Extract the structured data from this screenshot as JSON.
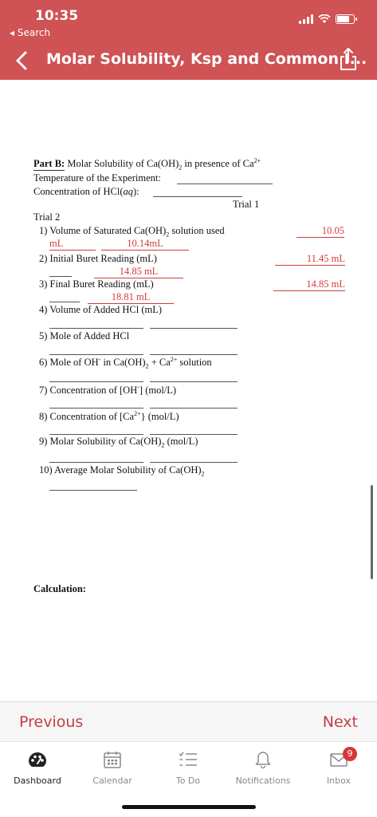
{
  "status_bar": {
    "time": "10:35",
    "back_label": "◂ Search"
  },
  "header": {
    "title": "Molar Solubility, Ksp and Common I..."
  },
  "document": {
    "part_label": "Part B:",
    "part_title": " Molar Solubility of Ca(OH)",
    "part_title_sub": "2",
    "part_title_rest": " in presence of Ca",
    "part_title_sup": "2+",
    "temperature_label": "Temperature of the Experiment:",
    "concentration_label": "Concentration of HCl(",
    "concentration_aq": "aq",
    "concentration_close": "):",
    "trial1_header": "Trial    1",
    "trial2_header": "Trial 2",
    "q1_label": "1) Volume of Saturated Ca(OH)",
    "q1_sub": "2",
    "q1_rest": " solution used",
    "q1_trial1": "10.05",
    "q1_unit": "mL",
    "q1_trial2": "10.14mL",
    "q2_label": "2)  Initial  Buret  Reading  (mL)",
    "q2_trial1": "11.45  mL",
    "q2_trial2": "14.85 mL",
    "q3_label": "3)  Final  Buret  Reading  (mL)",
    "q3_trial1": "14.85  mL",
    "q3_trial2": "18.81 mL",
    "q4_label": "4)      Volume      of      Added      HCl      (mL)",
    "q5_label": "5)        Mole        of        Added        HCl",
    "q6_label": "6)   Mole   of   OH",
    "q6_sup": "-",
    "q6_rest": "   in   Ca(OH)",
    "q6_sub": "2",
    "q6_rest2": "   +   Ca",
    "q6_sup2": "2+",
    "q6_rest3": "   solution",
    "q7_label": "7)      Concentration      of      [OH",
    "q7_sup": "-",
    "q7_rest": "]      (mol/L)",
    "q8_label": "8)        Concentration        of        [Ca",
    "q8_sup": "2+",
    "q8_rest": "}        (mol/L)",
    "q9_label": "9)    Molar    Solubility    of    Ca(OH)",
    "q9_sub": "2",
    "q9_rest": "    (mol/L)",
    "q10_label": "10) Average Molar Solubility of Ca(OH)",
    "q10_sub": "2",
    "calculation_label": "Calculation:"
  },
  "nav": {
    "previous": "Previous",
    "next": "Next"
  },
  "tabbar": {
    "items": [
      {
        "label": "Dashboard",
        "icon": "dashboard-icon"
      },
      {
        "label": "Calendar",
        "icon": "calendar-icon"
      },
      {
        "label": "To Do",
        "icon": "todo-icon"
      },
      {
        "label": "Notifications",
        "icon": "bell-icon"
      },
      {
        "label": "Inbox",
        "icon": "inbox-icon"
      }
    ],
    "inbox_badge": "9"
  },
  "colors": {
    "header_bg": "#cf5254",
    "accent": "#c43f42",
    "handwriting_red": "#d23a3a",
    "badge": "#d3373a"
  }
}
